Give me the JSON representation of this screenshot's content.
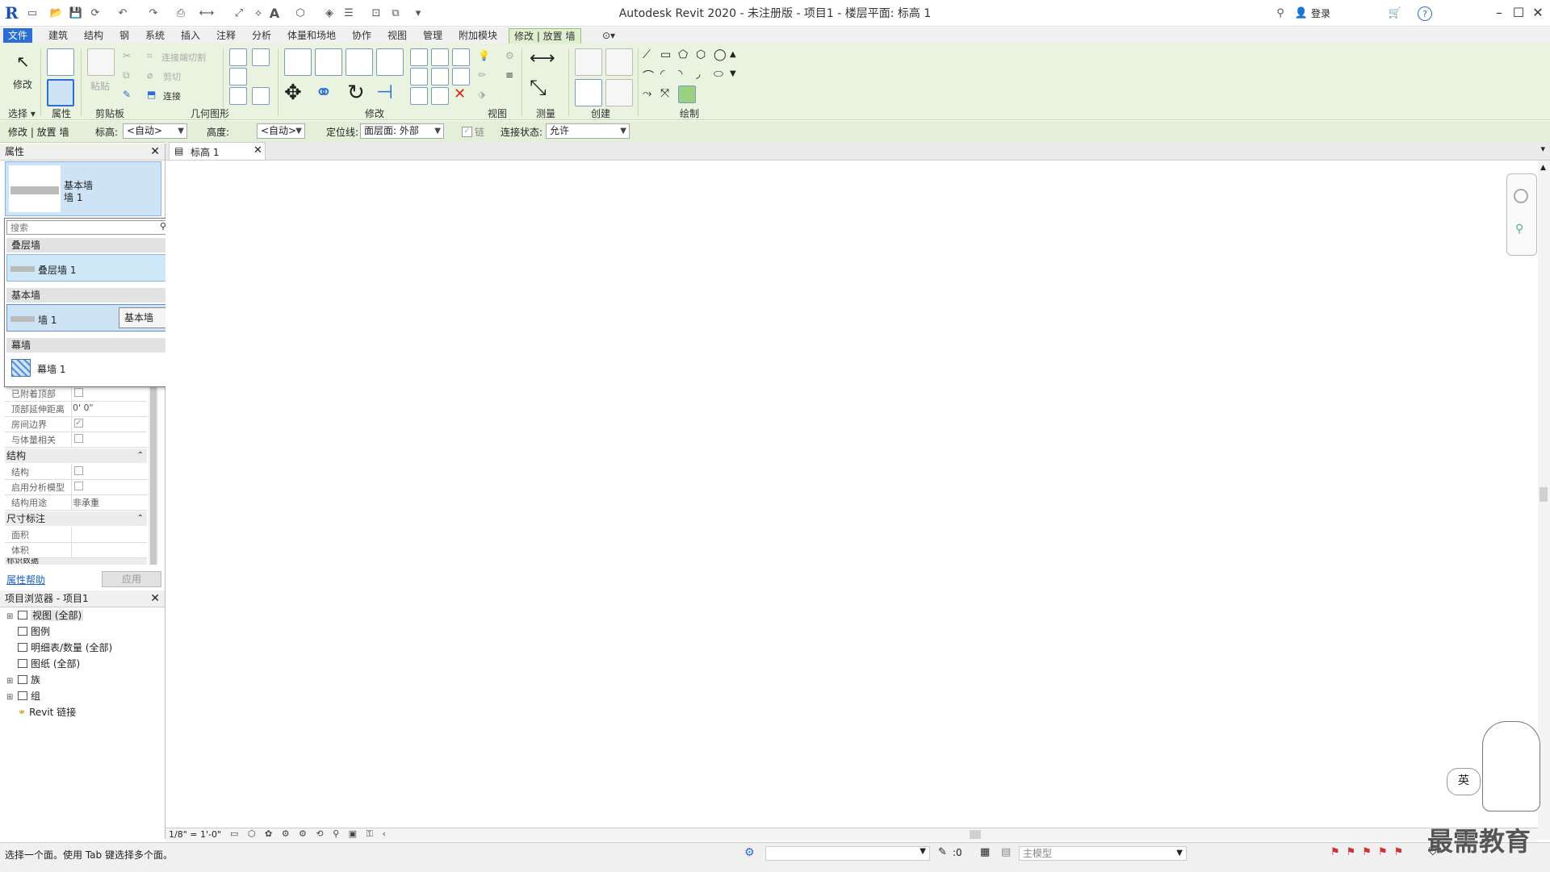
{
  "app": {
    "title": "Autodesk Revit 2020 - 未注册版 - 项目1 - 楼层平面: 标高 1",
    "logo": "R"
  },
  "titlebar": {
    "login": "登录",
    "help": "?"
  },
  "menu": {
    "tabs": [
      "文件",
      "建筑",
      "结构",
      "钢",
      "系统",
      "插入",
      "注释",
      "分析",
      "体量和场地",
      "协作",
      "视图",
      "管理",
      "附加模块",
      "修改 | 放置 墙"
    ]
  },
  "ribbon": {
    "modify_label": "修改",
    "select_label": "选择",
    "properties_label": "属性",
    "clipboard": {
      "paste": "粘贴",
      "cut_join": "连接端切割",
      "cut": "剪切",
      "join": "连接"
    },
    "groups": [
      "选择",
      "属性",
      "剪贴板",
      "几何图形",
      "修改",
      "视图",
      "测量",
      "创建",
      "绘制"
    ]
  },
  "options_bar": {
    "context": "修改 | 放置 墙",
    "level_label": "标高:",
    "level_value": "<自动>",
    "height_label": "高度:",
    "height_value": "<自动>",
    "location_label": "定位线:",
    "location_value": "面层面: 外部",
    "chain_label": "链",
    "join_label": "连接状态:",
    "join_value": "允许"
  },
  "properties": {
    "title": "属性",
    "type_family": "基本墙",
    "type_name": "墙 1",
    "rows1": [
      {
        "k": "已附着顶部",
        "check": ""
      },
      {
        "k": "顶部延伸距离",
        "v": "0'  0\""
      },
      {
        "k": "房间边界",
        "check": "✓"
      },
      {
        "k": "与体量相关",
        "check": ""
      }
    ],
    "cat_structure": "结构",
    "rows2": [
      {
        "k": "结构",
        "check": ""
      },
      {
        "k": "启用分析模型",
        "check": ""
      },
      {
        "k": "结构用途",
        "v": "非承重"
      }
    ],
    "cat_dimensions": "尺寸标注",
    "rows3": [
      {
        "k": "面积",
        "v": ""
      },
      {
        "k": "体积",
        "v": ""
      }
    ],
    "cat_identity": "标识数据",
    "help_link": "属性帮助",
    "apply": "应用"
  },
  "type_dropdown": {
    "search_placeholder": "搜索",
    "groups": [
      {
        "name": "叠层墙",
        "item": "叠层墙 1"
      },
      {
        "name": "基本墙",
        "item": "墙 1",
        "tooltip": "基本墙"
      },
      {
        "name": "幕墙",
        "item": "幕墙 1"
      }
    ]
  },
  "project_browser": {
    "title": "项目浏览器 - 项目1",
    "items": [
      {
        "label": "视图 (全部)",
        "expand": "⊞"
      },
      {
        "label": "图例",
        "expand": ""
      },
      {
        "label": "明细表/数量 (全部)",
        "expand": ""
      },
      {
        "label": "图纸 (全部)",
        "expand": ""
      },
      {
        "label": "族",
        "expand": "⊞"
      },
      {
        "label": "组",
        "expand": "⊞"
      },
      {
        "label": "Revit 链接",
        "expand": ""
      }
    ]
  },
  "view": {
    "tab_label": "标高 1",
    "scale": "1/8\" = 1'-0\""
  },
  "status": {
    "message": "选择一个面。使用 Tab 键选择多个面。",
    "count": ":0",
    "model": "主模型",
    "ime": "英"
  },
  "watermark": "最需教育",
  "colors": {
    "accent": "#2a6ed6",
    "ribbon_bg": "#e9f3df",
    "selection": "#cfe3f7"
  }
}
